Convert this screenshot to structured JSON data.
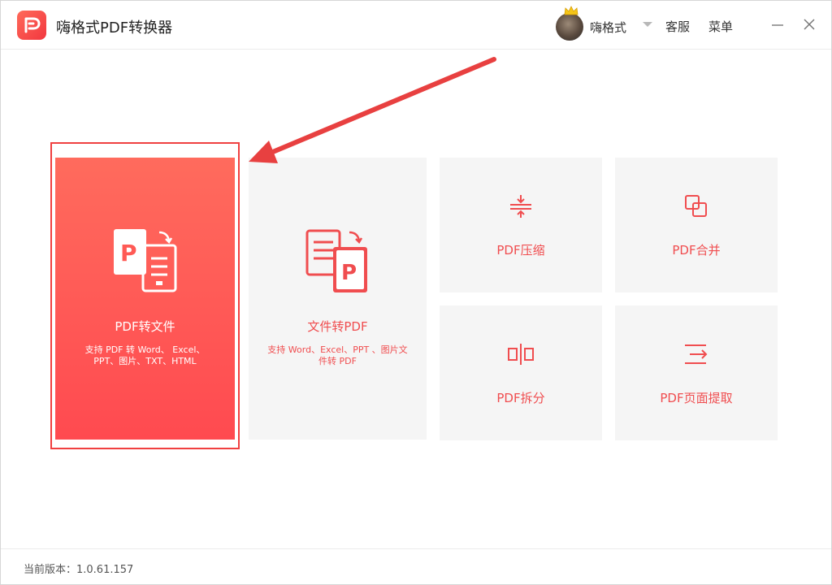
{
  "app": {
    "title": "嗨格式PDF转换器"
  },
  "header": {
    "user_name": "嗨格式",
    "service_label": "客服",
    "menu_label": "菜单"
  },
  "cards": {
    "pdf_to_file": {
      "label": "PDF转文件",
      "sub_line1": "支持 PDF 转 Word、 Excel、",
      "sub_line2": "PPT、图片、TXT、HTML"
    },
    "file_to_pdf": {
      "label": "文件转PDF",
      "sub_line1": "支持 Word、Excel、PPT 、图片文",
      "sub_line2": "件转 PDF"
    },
    "compress": {
      "label": "PDF压缩"
    },
    "merge": {
      "label": "PDF合并"
    },
    "split": {
      "label": "PDF拆分"
    },
    "extract": {
      "label": "PDF页面提取"
    }
  },
  "footer": {
    "version_text": "当前版本：1.0.61.157"
  },
  "colors": {
    "accent": "#f04d4f",
    "card_bg": "#f5f5f5",
    "annotation": "#e84040"
  },
  "icons": [
    "logo-icon",
    "crown-icon",
    "minimize-icon",
    "close-icon",
    "pdf-to-file-icon",
    "file-to-pdf-icon",
    "compress-icon",
    "merge-icon",
    "split-icon",
    "extract-icon"
  ]
}
